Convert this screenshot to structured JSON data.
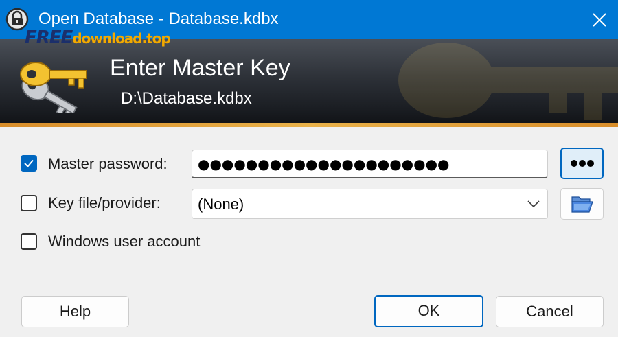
{
  "window": {
    "title": "Open Database - Database.kdbx",
    "watermark_part1": "FREE",
    "watermark_part2": "download.top"
  },
  "banner": {
    "title": "Enter Master Key",
    "subtitle": "D:\\Database.kdbx"
  },
  "form": {
    "master_password": {
      "label": "Master password:",
      "checked": true,
      "value": "●●●●●●●●●●●●●●●●●●●●●"
    },
    "key_file": {
      "label": "Key file/provider:",
      "checked": false,
      "selected": "(None)"
    },
    "windows_account": {
      "label": "Windows user account",
      "checked": false
    }
  },
  "buttons": {
    "help": "Help",
    "ok": "OK",
    "cancel": "Cancel"
  },
  "colors": {
    "titlebar": "#0078d4",
    "accent": "#0067c0"
  },
  "icons": [
    "lock-icon",
    "close-icon",
    "key-icon",
    "show-password-icon",
    "folder-open-icon",
    "chevron-down-icon",
    "checkmark-icon"
  ]
}
